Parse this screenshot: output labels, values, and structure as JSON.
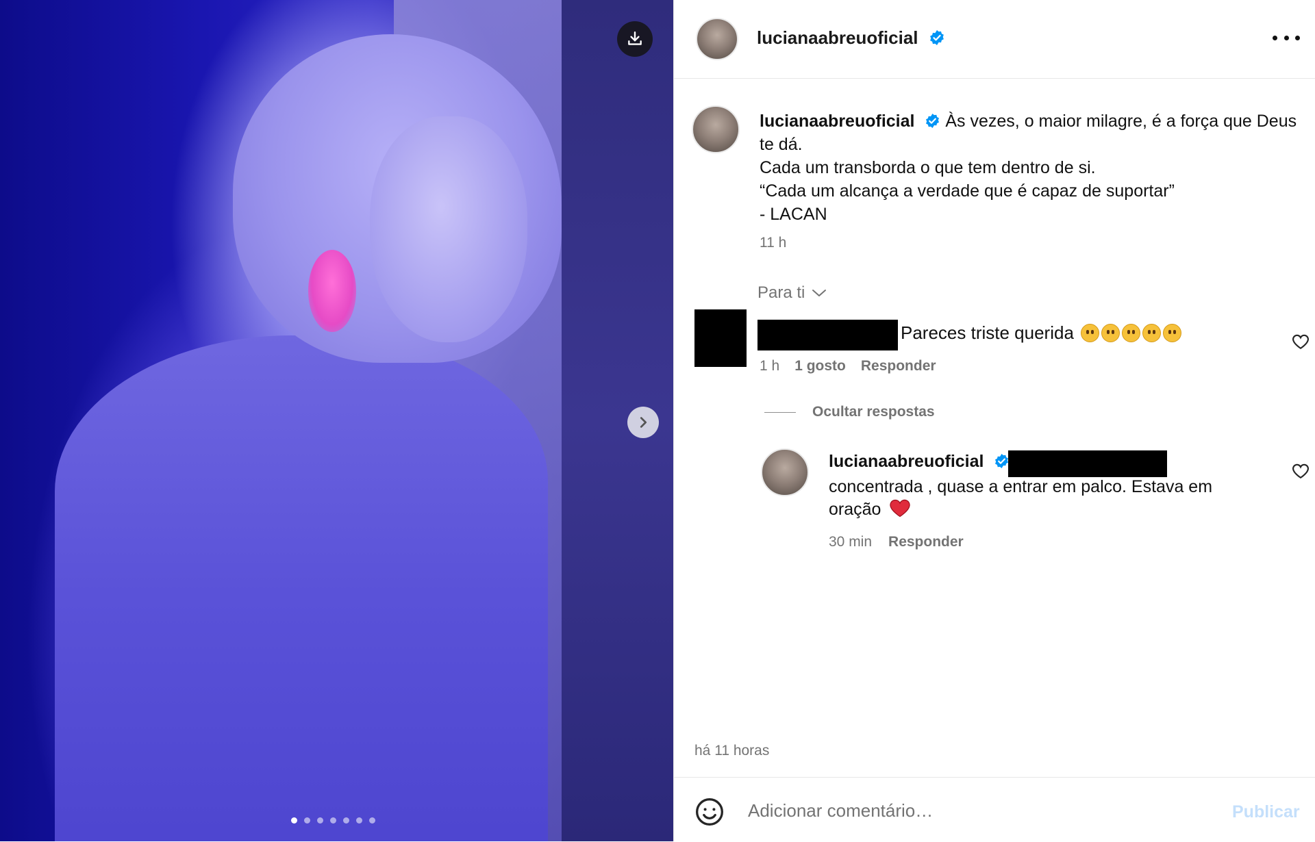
{
  "post": {
    "username": "lucianaabreuoficial",
    "verified": true,
    "more_icon": "more-horizontal-icon",
    "media": {
      "description_icons": [
        "download-icon",
        "chevron-right-icon"
      ],
      "carousel_count": 7,
      "carousel_active": 0
    }
  },
  "caption": {
    "username": "lucianaabreuoficial",
    "lines": [
      "Às vezes, o maior milagre, é a força que Deus te dá.",
      "Cada um transborda o que tem dentro de si.",
      "“Cada um alcança a verdade que é capaz de suportar”",
      "- LACAN"
    ],
    "time": "11 h"
  },
  "sort": {
    "label": "Para ti"
  },
  "comments": [
    {
      "text": "Pareces triste querida",
      "emoji_count": 5,
      "time": "1 h",
      "likes": "1 gosto",
      "reply_label": "Responder",
      "hide_replies_label": "Ocultar respostas",
      "replies": [
        {
          "username": "lucianaabreuoficial",
          "text": "concentrada , quase a entrar em palco. Estava em oração",
          "time": "30 min",
          "reply_label": "Responder"
        }
      ]
    }
  ],
  "footer": {
    "posted": "há 11 horas",
    "comment_placeholder": "Adicionar comentário…",
    "publish_label": "Publicar"
  },
  "colors": {
    "verified": "#0095f6",
    "muted": "#737373",
    "publish_disabled": "#c4dffb",
    "heart_red": "#e02b3c"
  }
}
